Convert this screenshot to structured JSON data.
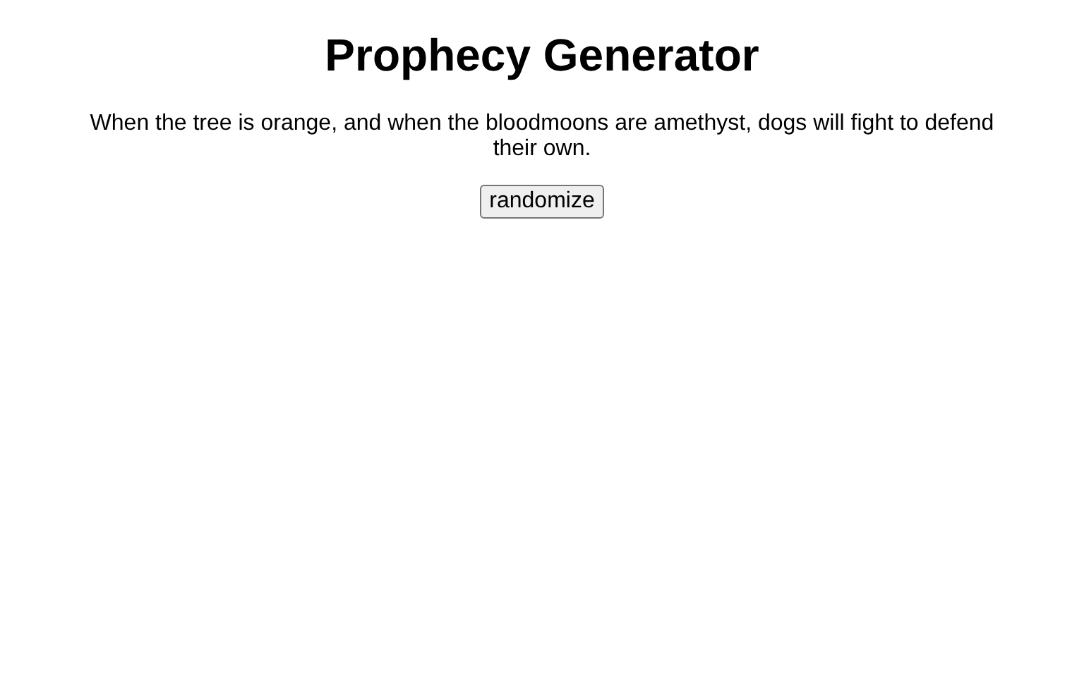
{
  "title": "Prophecy Generator",
  "prophecy": "When the tree is orange, and when the bloodmoons are amethyst, dogs will fight to defend their own.",
  "button": {
    "label": "randomize"
  }
}
